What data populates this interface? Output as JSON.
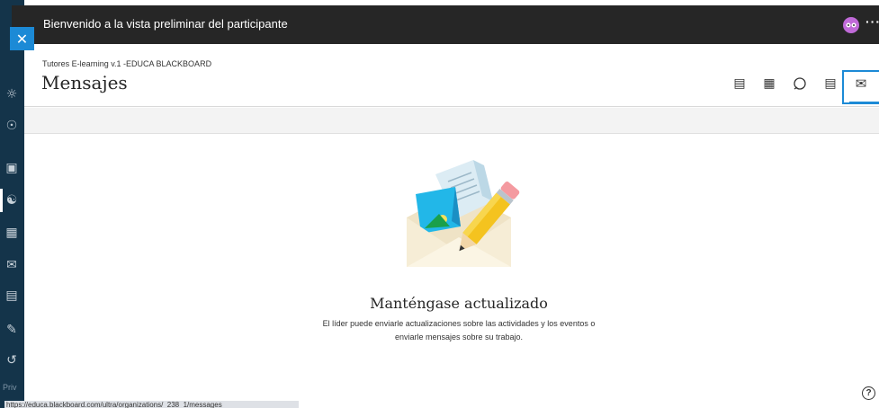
{
  "preview_bar": {
    "title": "Bienvenido a la vista preliminar del participante",
    "more": "···"
  },
  "header": {
    "breadcrumb": "Tutores E-learning v.1 -EDUCA BLACKBOARD",
    "page_title": "Mensajes"
  },
  "header_icons": [
    "calendar-page-icon",
    "calendar-grid-icon",
    "discussion-icon",
    "notes-icon",
    "messages-icon"
  ],
  "left_rail": {
    "icons": [
      "profile-icon",
      "globe-icon",
      "courses-icon",
      "people-icon",
      "calendar-icon",
      "mail-icon",
      "grades-icon",
      "edit-icon",
      "signout-icon"
    ],
    "privacy_label": "Priv"
  },
  "empty_state": {
    "title": "Manténgase actualizado",
    "description_line1": "El líder puede enviarle actualizaciones sobre las actividades y los eventos o",
    "description_line2": "enviarle mensajes sobre su trabajo."
  },
  "status_bar": {
    "url": "https://educa.blackboard.com/ultra/organizations/_238_1/messages"
  },
  "colors": {
    "accent": "#1c8ad6",
    "rail": "#14344a",
    "topbar": "#262626",
    "avatar": "#c06ad8"
  }
}
